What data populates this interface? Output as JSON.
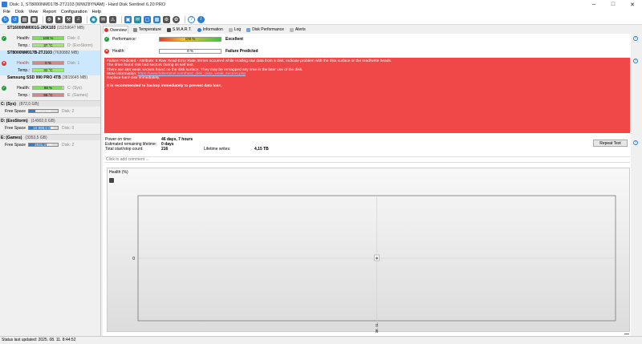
{
  "window": {
    "title": "Disk: 1, ST8000NM017B-2TJ103 [WWZ8YNAM]  -  Hard Disk Sentinel 6.20 PRO",
    "minimize": "–",
    "maximize": "□",
    "close": "✕"
  },
  "menu": [
    "File",
    "Disk",
    "View",
    "Report",
    "Configuration",
    "Help"
  ],
  "disks": [
    {
      "name": "ST16000NM001G-2KK103",
      "size": "(15259647 MB)",
      "status": "ok",
      "health_label": "Health:",
      "health_value": "100 %",
      "health_pct": 100,
      "temp_label": "Temp.:",
      "temp_value": "37 °C",
      "disk_ref": "Disk: 0",
      "drive_ref": "D: (ExoStorm)",
      "selected": false
    },
    {
      "name": "ST8000NM017B-2TJ103",
      "size": "(7630882 MB)",
      "status": "bad",
      "health_label": "Health:",
      "health_value": "0 %",
      "health_pct": 0,
      "temp_label": "Temp.:",
      "temp_value": "32 °C",
      "disk_ref": "Disk: 1",
      "drive_ref": "",
      "selected": true
    },
    {
      "name": "Samsung SSD 990 PRO 4TB",
      "size": "(3815645 MB)",
      "status": "ok",
      "health_label": "Health:",
      "health_value": "98 %",
      "health_pct": 98,
      "temp_label": "Temp.:",
      "temp_value": "55 °C",
      "disk_ref": "C: (Sys)",
      "drive_ref": "E: (Games)",
      "selected": false
    }
  ],
  "volumes": [
    {
      "letter": "C: (Sys)",
      "size": "(872,0 GB)",
      "free_label": "Free Space",
      "free_value": "187,2 GB",
      "free_pct": 22,
      "disk": "Disk: 2"
    },
    {
      "letter": "D: (ExoStorm)",
      "size": "(14902,0 GB)",
      "free_label": "Free Space",
      "free_value": "10 998,0 GB",
      "free_pct": 74,
      "disk": "Disk: 0"
    },
    {
      "letter": "E: (Games)",
      "size": "(3353,5 GB)",
      "free_label": "Free Space",
      "free_value": "2031,3 GB",
      "free_pct": 61,
      "disk": "Disk: 2"
    }
  ],
  "tabs": [
    "Overview",
    "Temperature",
    "S.M.A.R.T.",
    "Information",
    "Log",
    "Disk Performance",
    "Alerts"
  ],
  "overview": {
    "performance_label": "Performance:",
    "performance_value": "100 %",
    "performance_pct": 100,
    "performance_verdict": "Excellent",
    "health_label": "Health:",
    "health_value": "0 %",
    "health_pct": 0,
    "health_verdict": "Failure Predicted",
    "alert_lines": [
      "Failure Predicted - Attribute: 5 Raw Read Error Rate, Errors occurred while reading raw data from a disk. Indicate problem with the disk surface or the read/write heads.",
      "The drive found 488 bad sectors during its self test.",
      "There are 488 weak sectors found on the disk surface. They may be remapped any time in the later use of the disk.",
      "Replace hard disk immediately."
    ],
    "alert_more_label": "More information:",
    "alert_link": "https://www.hdsentinel.com/hard_disk_case_weak_sectors.php",
    "alert_strong": "It is recommended to backup immediately to prevent data loss.",
    "power_on_label": "Power on time:",
    "power_on_value": "46 days, 7 hours",
    "lifetime_label": "Estimated remaining lifetime:",
    "lifetime_value": "0 days",
    "startstop_label": "Total start/stop count:",
    "startstop_value": "216",
    "writes_label": "Lifetime writes:",
    "writes_value": "4,15 TB",
    "repeat_button": "Repeat Test",
    "comment_placeholder": "Click to add comment ...",
    "help_glyph": "?"
  },
  "chart_data": {
    "type": "line",
    "title": "Health (%)",
    "x": [
      "2025. 08. 11."
    ],
    "series": [
      {
        "values": [
          0
        ]
      }
    ],
    "point_labels": [
      "0"
    ],
    "ytick_labels": [
      "0"
    ],
    "grid": true
  },
  "status_bar": "Status last updated: 2025. 08. 11. 8:44:52",
  "colors": {
    "ok": "#1a9c3a",
    "bad": "#d9322b",
    "alert_bg": "#f04848",
    "selected_bg": "#cce8ff",
    "volume_bar": "#2b7fd4"
  }
}
